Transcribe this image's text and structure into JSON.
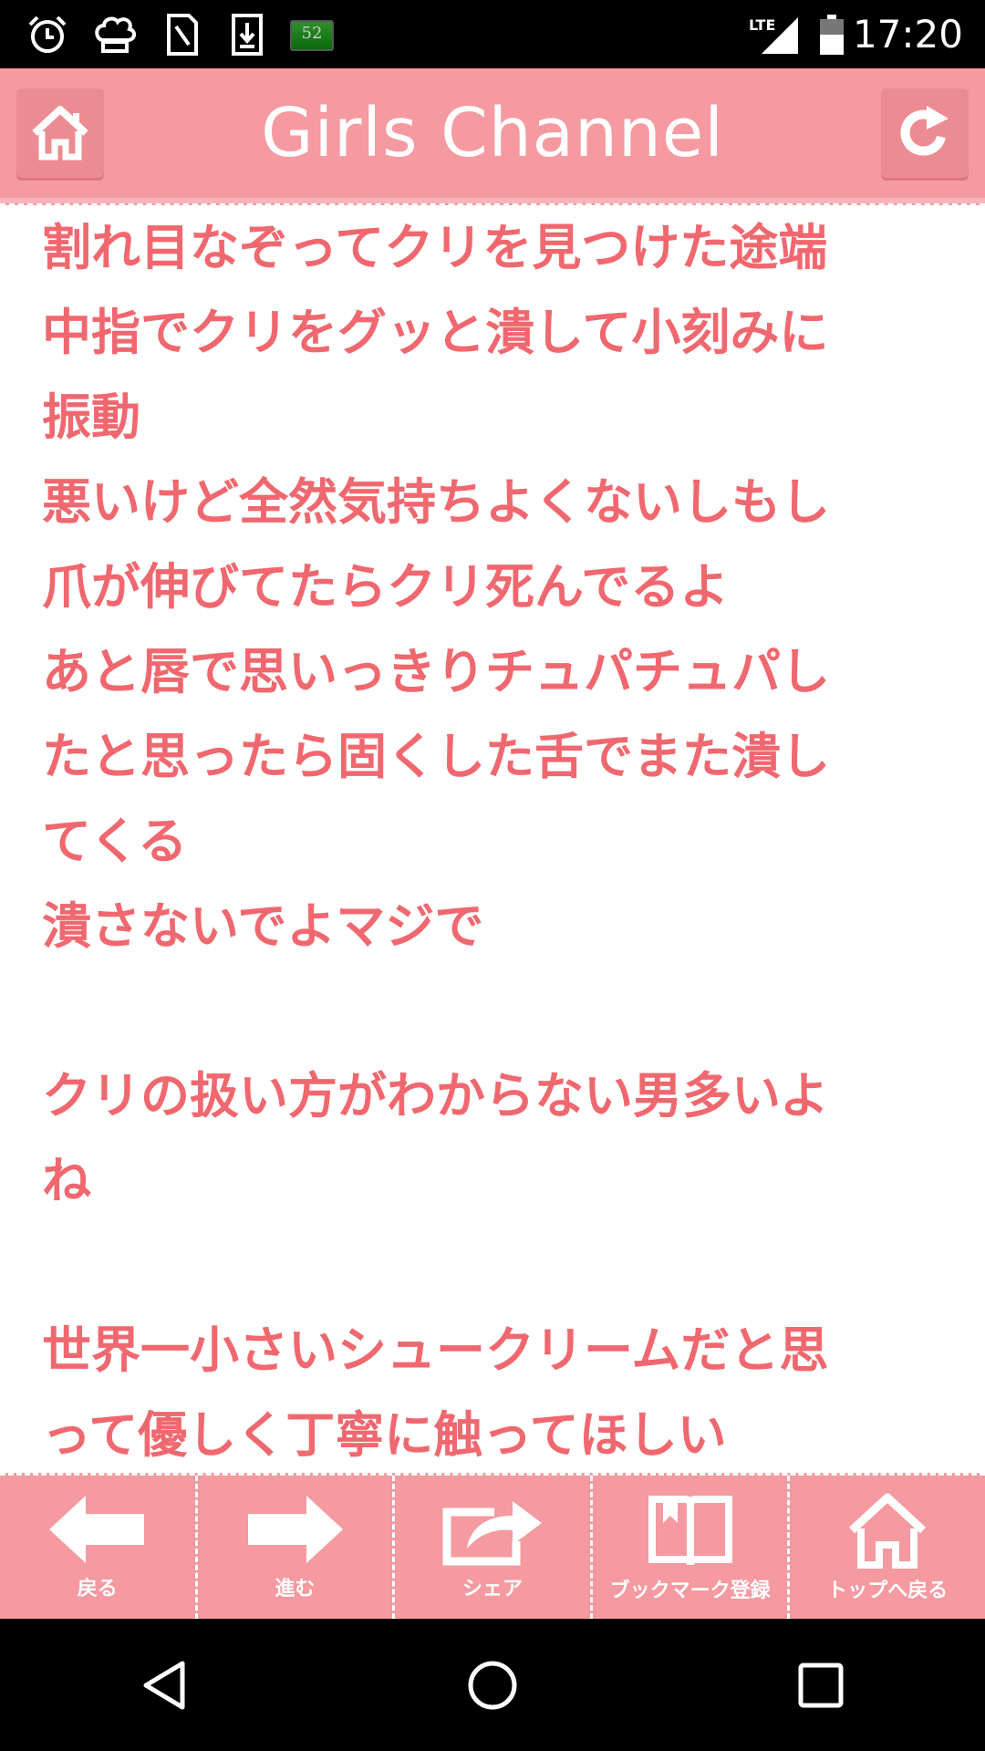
{
  "status_bar": {
    "time": "17:20",
    "network": "LTE",
    "battery_badge": "52",
    "icons": [
      "alarm-icon",
      "chef-hat-icon",
      "sim-card-icon",
      "download-icon",
      "battery-badge-icon",
      "lte-signal-icon",
      "battery-icon"
    ]
  },
  "header": {
    "title": "Girls Channel",
    "left_button": "home-icon",
    "right_button": "refresh-icon"
  },
  "content": {
    "text": "割れ目なぞってクリを見つけた途端\n中指でクリをグッと潰して小刻みに\n振動\n悪いけど全然気持ちよくないしもし\n爪が伸びてたらクリ死んでるよ\nあと唇で思いっきりチュパチュパし\nたと思ったら固くした舌でまた潰し\nてくる\n潰さないでよマジで\n\nクリの扱い方がわからない男多いよ\nね\n\n世界一小さいシュークリームだと思\nって優しく丁寧に触ってほしい"
  },
  "toolbar": {
    "items": [
      {
        "label": "戻る",
        "icon": "arrow-left-icon"
      },
      {
        "label": "進む",
        "icon": "arrow-right-icon"
      },
      {
        "label": "シェア",
        "icon": "share-icon"
      },
      {
        "label": "ブックマーク登録",
        "icon": "bookmark-book-icon"
      },
      {
        "label": "トップへ戻る",
        "icon": "home-icon"
      }
    ]
  },
  "nav_bar": {
    "buttons": [
      "back-triangle-icon",
      "home-circle-icon",
      "recents-square-icon"
    ]
  },
  "colors": {
    "accent": "#f49aa0",
    "text": "#f0686f"
  }
}
